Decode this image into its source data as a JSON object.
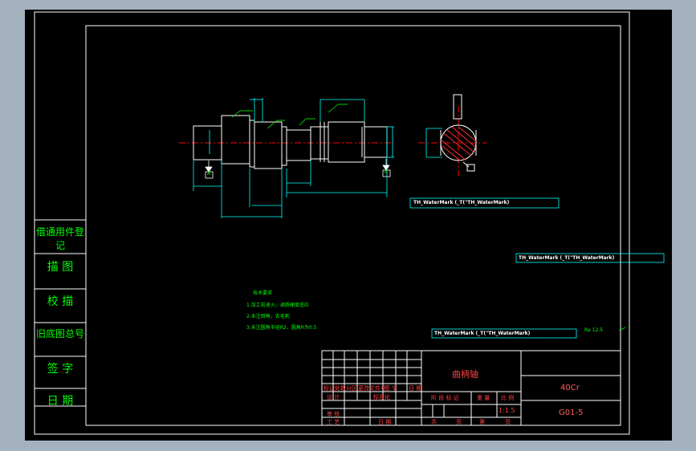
{
  "side_labels": [
    "借通用件登记",
    "描 图",
    "校 描",
    "旧底图总号",
    "签 字",
    "日 期"
  ],
  "tech_notes": {
    "title": "技术要求",
    "items": [
      "1.加工前退火，调质硬度适应",
      "2.未注倒角，去毛刺",
      "3.未注圆角半径R2，圆角R为0.5"
    ]
  },
  "watermarks": [
    "TH_WaterMark (_T(\"TH_WaterMark)",
    "TH_WaterMark (_T(\"TH_WaterMark)",
    "TH_WaterMark (_T(\"TH_WaterMark)"
  ],
  "surface_note": "Ra 12.5",
  "title_block": {
    "part_name": "曲柄轴",
    "material": "40Cr",
    "drawing_number": "G01-5",
    "scale": "1:1.5",
    "row_headers": [
      "标记",
      "处数",
      "分区",
      "更改文件号",
      "签 字",
      "日 期"
    ],
    "design": "设 计",
    "standardize": "标准化",
    "review": "审 核",
    "process": "工 艺",
    "date": "日 期",
    "stage_mark": "阶 段 标 记",
    "weight": "重 量",
    "ratio": "比 例",
    "total": "共",
    "sheet_of": "页",
    "sheet_no": "第",
    "sheet_pg": "页"
  },
  "datum_labels": [
    "A",
    "B"
  ],
  "colors": {
    "border": "#ffffff",
    "dimension": "#00ffff",
    "text": "#00ff00",
    "centerline": "#ff0000",
    "part": "#ffffff",
    "background": "#000000"
  }
}
